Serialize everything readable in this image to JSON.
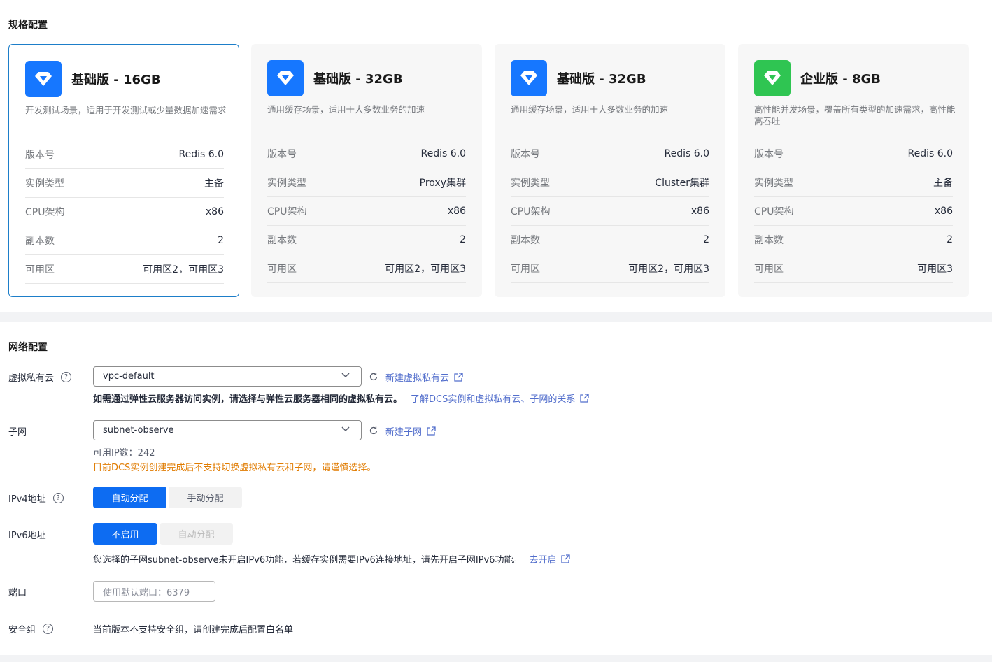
{
  "spec": {
    "title": "规格配置",
    "cards": [
      {
        "title": "基础版 - 16GB",
        "desc": "开发测试场景，适用于开发测试或少量数据加速需求",
        "icon": "diamond-icon",
        "color": "#1677ff",
        "selected": true,
        "rows": [
          {
            "k": "版本号",
            "v": "Redis 6.0"
          },
          {
            "k": "实例类型",
            "v": "主备"
          },
          {
            "k": "CPU架构",
            "v": "x86"
          },
          {
            "k": "副本数",
            "v": "2"
          },
          {
            "k": "可用区",
            "v": "可用区2，可用区3"
          }
        ]
      },
      {
        "title": "基础版 - 32GB",
        "desc": "通用缓存场景，适用于大多数业务的加速",
        "icon": "diamond-icon",
        "color": "#1677ff",
        "selected": false,
        "rows": [
          {
            "k": "版本号",
            "v": "Redis 6.0"
          },
          {
            "k": "实例类型",
            "v": "Proxy集群"
          },
          {
            "k": "CPU架构",
            "v": "x86"
          },
          {
            "k": "副本数",
            "v": "2"
          },
          {
            "k": "可用区",
            "v": "可用区2，可用区3"
          }
        ]
      },
      {
        "title": "基础版 - 32GB",
        "desc": "通用缓存场景，适用于大多数业务的加速",
        "icon": "diamond-icon",
        "color": "#1677ff",
        "selected": false,
        "rows": [
          {
            "k": "版本号",
            "v": "Redis 6.0"
          },
          {
            "k": "实例类型",
            "v": "Cluster集群"
          },
          {
            "k": "CPU架构",
            "v": "x86"
          },
          {
            "k": "副本数",
            "v": "2"
          },
          {
            "k": "可用区",
            "v": "可用区2，可用区3"
          }
        ]
      },
      {
        "title": "企业版 - 8GB",
        "desc": "高性能并发场景，覆盖所有类型的加速需求，高性能高吞吐",
        "icon": "diamond-icon",
        "color": "#2fc552",
        "selected": false,
        "rows": [
          {
            "k": "版本号",
            "v": "Redis 6.0"
          },
          {
            "k": "实例类型",
            "v": "主备"
          },
          {
            "k": "CPU架构",
            "v": "x86"
          },
          {
            "k": "副本数",
            "v": "2"
          },
          {
            "k": "可用区",
            "v": "可用区3"
          }
        ]
      }
    ]
  },
  "network": {
    "title": "网络配置",
    "vpc": {
      "label": "虚拟私有云",
      "value": "vpc-default",
      "create_link": "新建虚拟私有云",
      "hint": "如需通过弹性云服务器访问实例，请选择与弹性云服务器相同的虚拟私有云。",
      "hint_link": "了解DCS实例和虚拟私有云、子网的关系"
    },
    "subnet": {
      "label": "子网",
      "value": "subnet-observe",
      "create_link": "新建子网",
      "available": "可用IP数：242",
      "warning": "目前DCS实例创建完成后不支持切换虚拟私有云和子网，请谨慎选择。"
    },
    "ipv4": {
      "label": "IPv4地址",
      "options": [
        "自动分配",
        "手动分配"
      ],
      "selected": "自动分配"
    },
    "ipv6": {
      "label": "IPv6地址",
      "options": [
        "不启用",
        "自动分配"
      ],
      "selected": "不启用",
      "hint": "您选择的子网subnet-observe未开启IPv6功能，若缓存实例需要IPv6连接地址，请先开启子网IPv6功能。",
      "hint_link": "去开启"
    },
    "port": {
      "label": "端口",
      "placeholder": "使用默认端口：6379"
    },
    "security_group": {
      "label": "安全组",
      "text": "当前版本不支持安全组，请创建完成后配置白名单"
    }
  },
  "colors": {
    "primary": "#0d6cf2",
    "link": "#526ecc",
    "warning": "#e07b00",
    "selected_border": "#1d7ec9"
  }
}
